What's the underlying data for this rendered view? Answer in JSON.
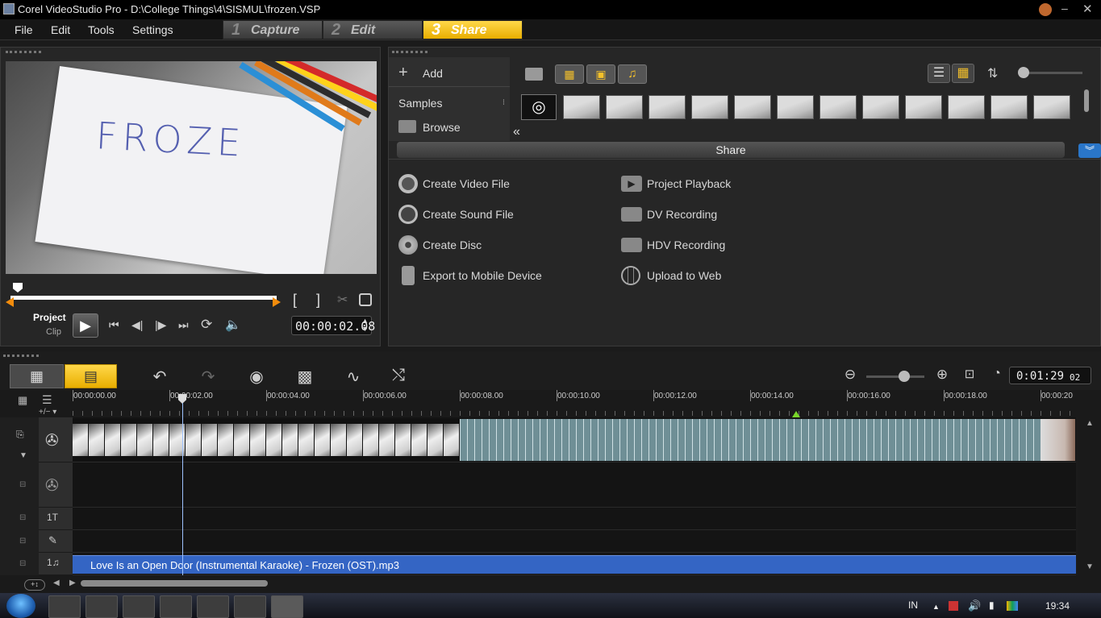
{
  "window": {
    "title": "Corel VideoStudio Pro - D:\\College Things\\4\\SISMUL\\frozen.VSP"
  },
  "menu": {
    "file": "File",
    "edit": "Edit",
    "tools": "Tools",
    "settings": "Settings"
  },
  "steps": [
    {
      "num": "1",
      "label": "Capture"
    },
    {
      "num": "2",
      "label": "Edit"
    },
    {
      "num": "3",
      "label": "Share"
    }
  ],
  "preview": {
    "mode_project": "Project",
    "mode_clip": "Clip",
    "timecode": "00:00:02.08",
    "frame_text": "FROZE"
  },
  "library": {
    "add": "Add",
    "samples": "Samples",
    "browse": "Browse",
    "share_title": "Share"
  },
  "share_options": {
    "create_video": "Create Video File",
    "create_sound": "Create Sound File",
    "create_disc": "Create Disc",
    "export_mobile": "Export to Mobile Device",
    "project_playback": "Project Playback",
    "dv_recording": "DV Recording",
    "hdv_recording": "HDV Recording",
    "upload_web": "Upload to Web"
  },
  "timeline": {
    "duration_main": "0:01:29",
    "duration_frames": "02",
    "ruler": [
      "00:00:00.00",
      "00:00:02.00",
      "00:00:04.00",
      "00:00:06.00",
      "00:00:08.00",
      "00:00:10.00",
      "00:00:12.00",
      "00:00:14.00",
      "00:00:16.00",
      "00:00:18.00",
      "00:00:20"
    ],
    "title_track": "1T",
    "music_track": "1♫",
    "audio_clip": "Love Is an Open Door (Instrumental Karaoke) - Frozen (OST).mp3"
  },
  "taskbar": {
    "lang": "IN",
    "clock": "19:34"
  },
  "colors": {
    "accent": "#f5c518",
    "audio_clip": "#3465c4",
    "video_strip": "#6f8f96"
  }
}
